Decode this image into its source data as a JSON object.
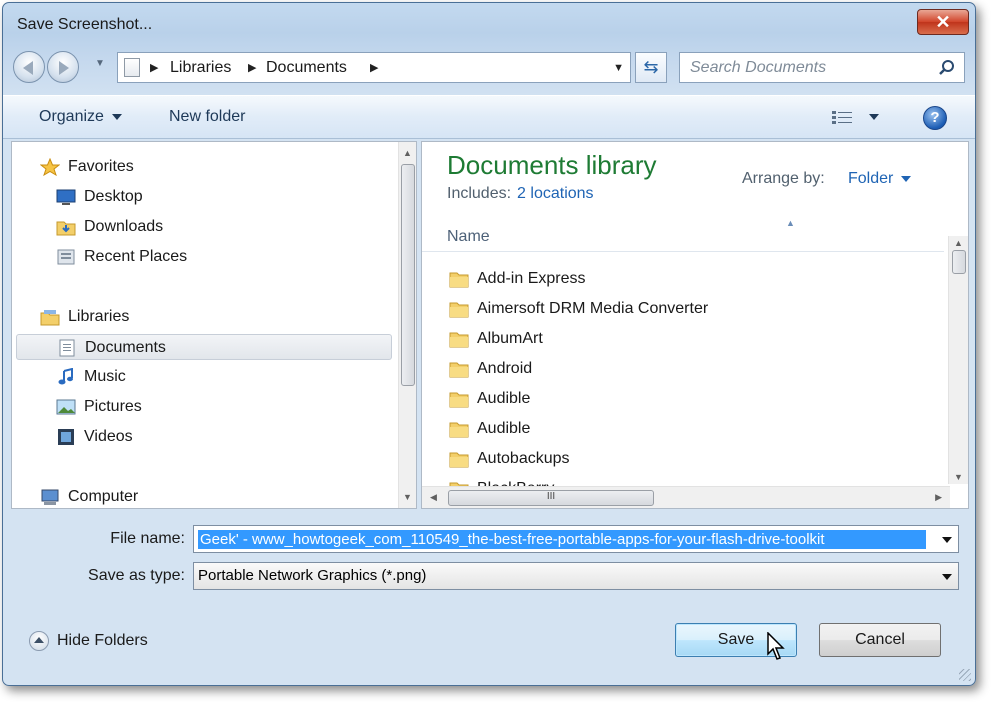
{
  "window": {
    "title": "Save Screenshot...",
    "close_glyph": "✕"
  },
  "address": {
    "crumbs": [
      "Libraries",
      "Documents"
    ],
    "separator": "▶",
    "dropdown": "▼"
  },
  "refresh_glyph": "⇆",
  "search": {
    "placeholder": "Search Documents"
  },
  "toolbar": {
    "organize": "Organize",
    "new_folder": "New folder",
    "help": "?"
  },
  "nav": {
    "favorites": "Favorites",
    "desktop": "Desktop",
    "downloads": "Downloads",
    "recent": "Recent Places",
    "libraries": "Libraries",
    "documents": "Documents",
    "music": "Music",
    "pictures": "Pictures",
    "videos": "Videos",
    "computer": "Computer"
  },
  "main": {
    "library_title": "Documents library",
    "includes_label": "Includes:",
    "includes_link": "2 locations",
    "arrange_label": "Arrange by:",
    "arrange_value": "Folder",
    "column_name": "Name",
    "files": [
      "Add-in Express",
      "Aimersoft DRM Media Converter",
      "AlbumArt",
      "Android",
      "Audible",
      "Audible",
      "Autobackups",
      "BlackBerry"
    ],
    "hscroll_grip": "III"
  },
  "form": {
    "file_name_label": "File name:",
    "file_name_value": "Geek' - www_howtogeek_com_110549_the-best-free-portable-apps-for-your-flash-drive-toolkit",
    "save_type_label": "Save as type:",
    "save_type_value": "Portable Network Graphics (*.png)"
  },
  "footer": {
    "hide_folders": "Hide Folders",
    "save": "Save",
    "cancel": "Cancel"
  },
  "colors": {
    "accent_green": "#1e7b34",
    "link_blue": "#1f64b4",
    "selection": "#3399ff",
    "close_red": "#c0341c"
  }
}
